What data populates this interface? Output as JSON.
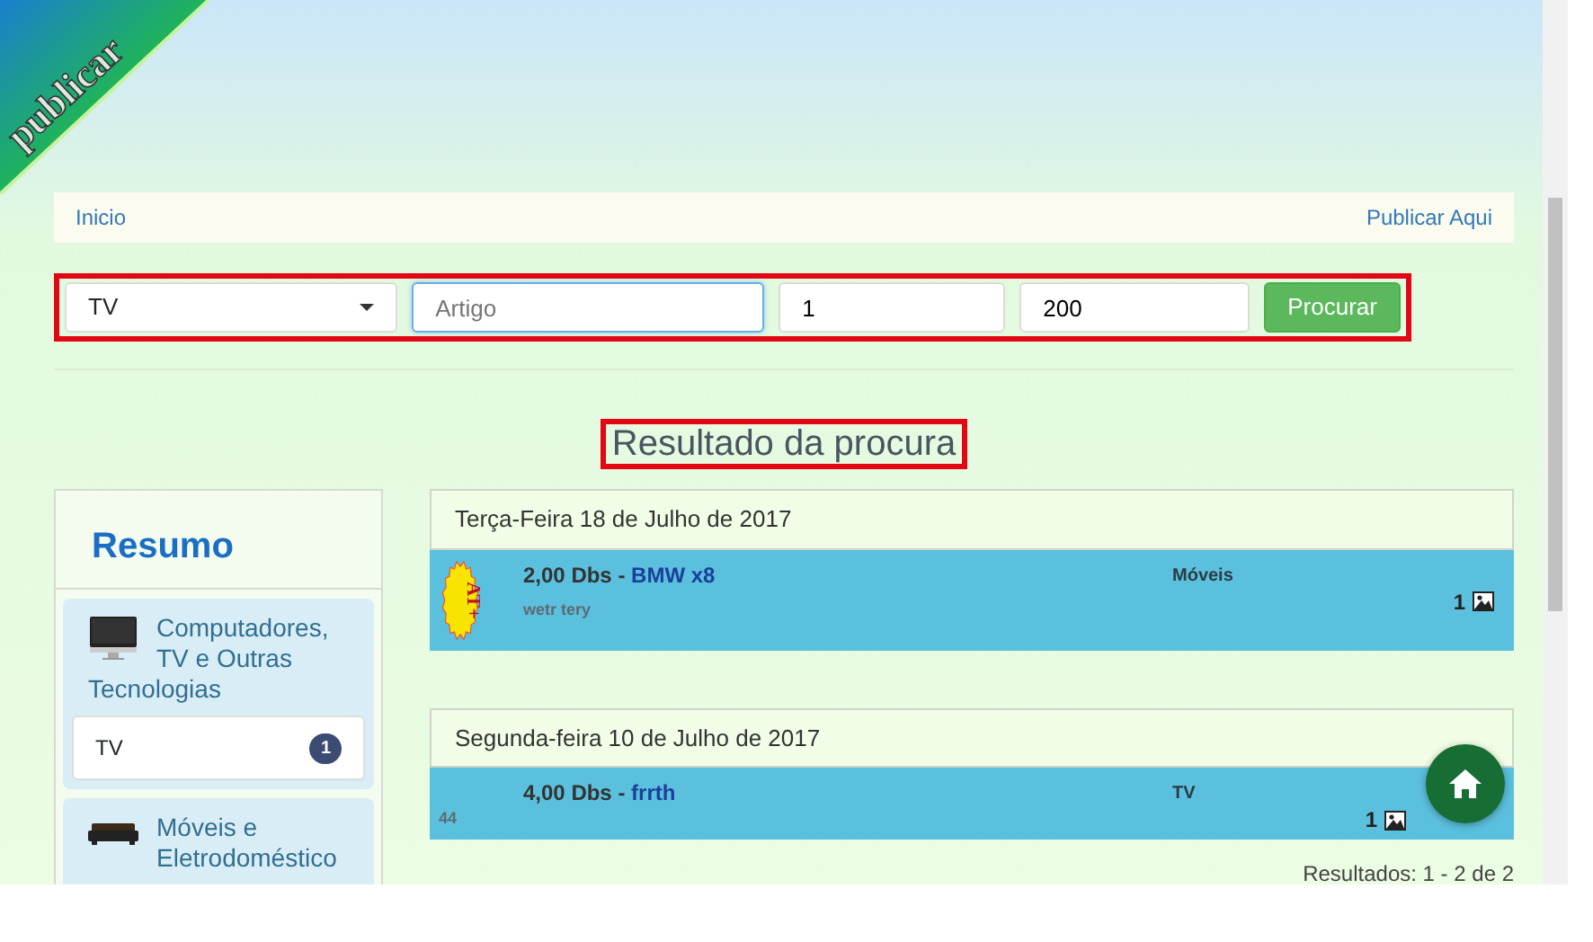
{
  "logo": {
    "text": "publicar"
  },
  "breadcrumb": {
    "home": "Inicio",
    "publish": "Publicar Aqui"
  },
  "search": {
    "category": "TV",
    "placeholder": "Artigo",
    "min": "1",
    "max": "200",
    "button": "Procurar"
  },
  "title": "Resultado da procura",
  "summary": {
    "heading": "Resumo",
    "groups": [
      {
        "name": "Computadores, TV e Outras Tecnologias",
        "kind": "computer",
        "items": [
          {
            "name": "TV",
            "count": "1"
          }
        ]
      },
      {
        "name": "Móveis e Eletrodoméstico",
        "kind": "furniture"
      }
    ]
  },
  "results": [
    {
      "date": "Terça-Feira 18 de Julho de 2017",
      "price": "2,00 Dbs - ",
      "title": "BMW x8",
      "category": "Móveis",
      "description": "wetr tery",
      "photos": "1",
      "featured": true,
      "badge": "AT+"
    },
    {
      "date": "Segunda-feira 10 de Julho de 2017",
      "price": "4,00 Dbs - ",
      "title": "frrth",
      "category": "TV",
      "code": "44",
      "photos": "1",
      "featured": false
    }
  ],
  "pagination": "Resultados: 1 - 2 de 2"
}
